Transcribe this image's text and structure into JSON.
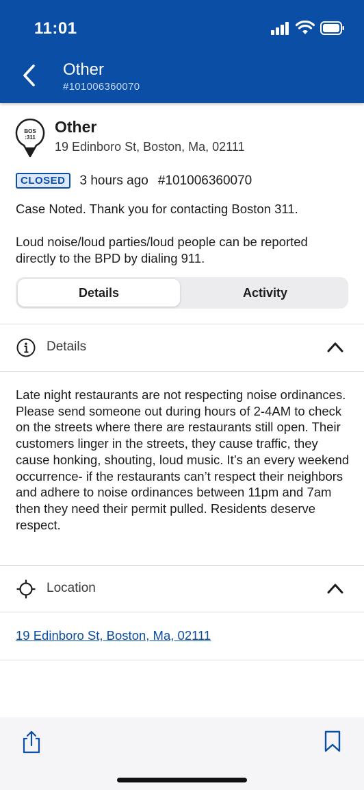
{
  "status_bar": {
    "time": "11:01",
    "icons": [
      "cellular-signal-icon",
      "wifi-icon",
      "battery-icon"
    ]
  },
  "nav": {
    "title": "Other",
    "subtitle": "#101006360070",
    "back_icon": "chevron-left-icon"
  },
  "case": {
    "pin_logo_line1": "BOS",
    "pin_logo_line2": ":311",
    "title": "Other",
    "address": "19 Edinboro St, Boston, Ma, 02111",
    "status_badge": "CLOSED",
    "time_ago": "3 hours ago",
    "case_number": "#101006360070",
    "note_1": "Case Noted. Thank you for contacting Boston 311.",
    "note_2": "Loud noise/loud parties/loud people can be reported directly to the BPD by dialing 911."
  },
  "tabs": [
    {
      "label": "Details",
      "active": true
    },
    {
      "label": "Activity",
      "active": false
    }
  ],
  "details_section": {
    "label": "Details",
    "icon": "info-icon",
    "expanded": true,
    "description": "Late night restaurants are not respecting noise ordinances. Please send someone out during hours of 2-4AM to check on the streets where there are restaurants still open. Their customers linger in the streets, they cause traffic, they cause honking, shouting, loud music. It’s an every weekend occurrence- if the restaurants can’t respect their neighbors and adhere to noise ordinances between 11pm and 7am then they need their permit pulled. Residents deserve respect."
  },
  "location_section": {
    "label": "Location",
    "icon": "crosshair-icon",
    "expanded": true,
    "address_link": "19 Edinboro St, Boston, Ma, 02111"
  },
  "toolbar": {
    "share_icon": "share-icon",
    "bookmark_icon": "bookmark-icon"
  },
  "colors": {
    "header_blue": "#0a4ea6",
    "link_blue": "#0a4ea6",
    "badge_bg": "#dce8f8"
  }
}
